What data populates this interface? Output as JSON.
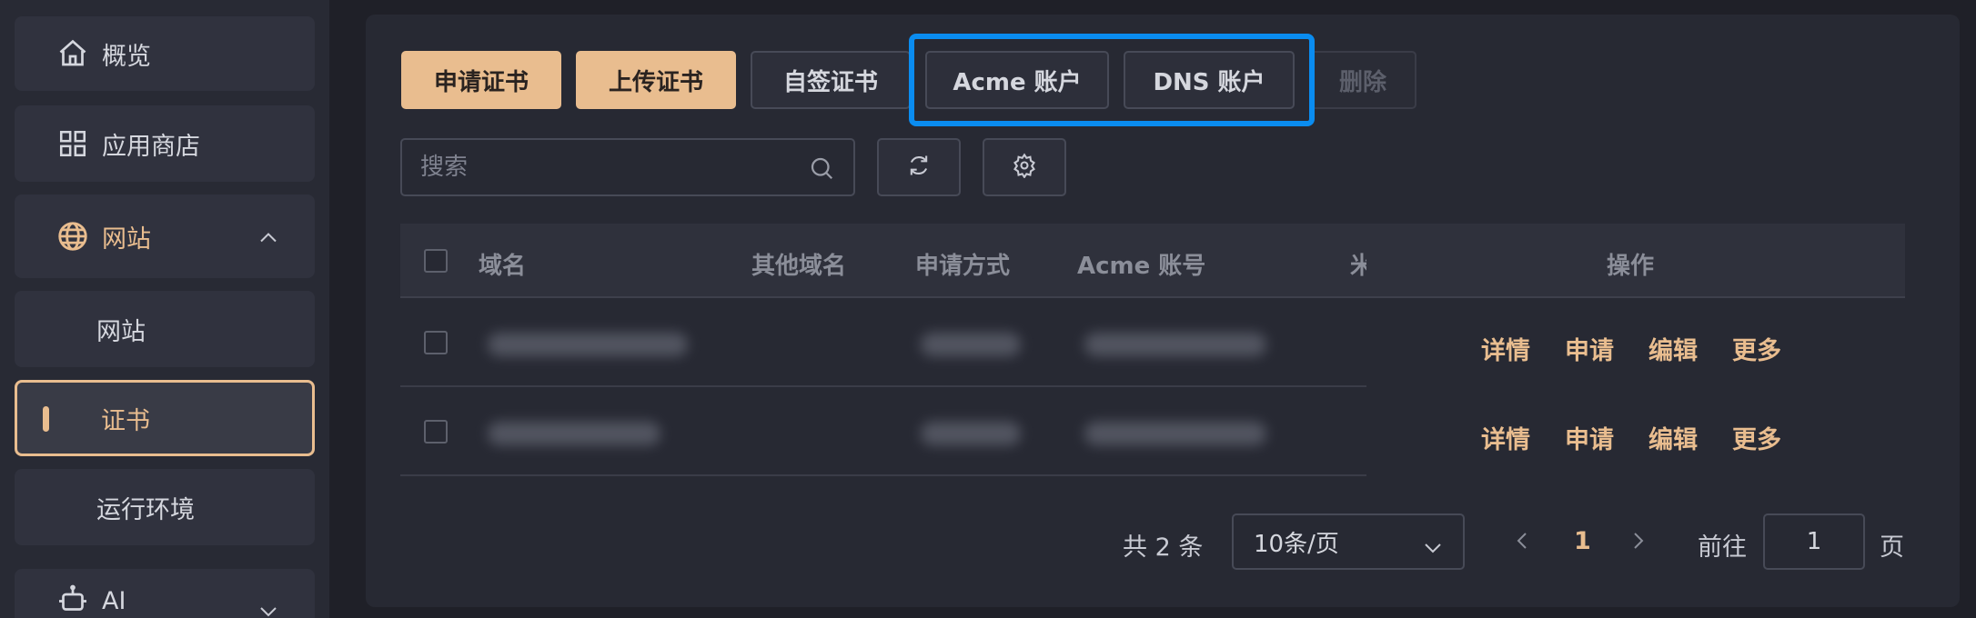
{
  "sidebar": {
    "items": [
      {
        "label": "概览",
        "icon": "home-icon"
      },
      {
        "label": "应用商店",
        "icon": "grid-icon"
      },
      {
        "label": "网站",
        "icon": "globe-icon"
      },
      {
        "label": "网站"
      },
      {
        "label": "证书"
      },
      {
        "label": "运行环境"
      },
      {
        "label": "AI",
        "icon": "robot-icon"
      }
    ]
  },
  "toolbar": {
    "apply_cert": "申请证书",
    "upload_cert": "上传证书",
    "self_signed": "自签证书",
    "acme_account": "Acme 账户",
    "dns_account": "DNS 账户",
    "delete": "删除"
  },
  "search": {
    "placeholder": "搜索"
  },
  "table": {
    "columns": [
      "域名",
      "其他域名",
      "申请方式",
      "Acme 账号",
      "米",
      "操作"
    ],
    "rows": [
      {
        "actions": [
          "详情",
          "申请",
          "编辑",
          "更多"
        ]
      },
      {
        "actions": [
          "详情",
          "申请",
          "编辑",
          "更多"
        ]
      }
    ]
  },
  "pagination": {
    "total": "共 2 条",
    "page_size": "10条/页",
    "current_page": "1",
    "goto_label": "前往",
    "goto_value": "1",
    "page_suffix": "页"
  },
  "colors": {
    "accent": "#e9bd8f",
    "highlight": "#0a8cf0",
    "background": "#1f2028"
  }
}
